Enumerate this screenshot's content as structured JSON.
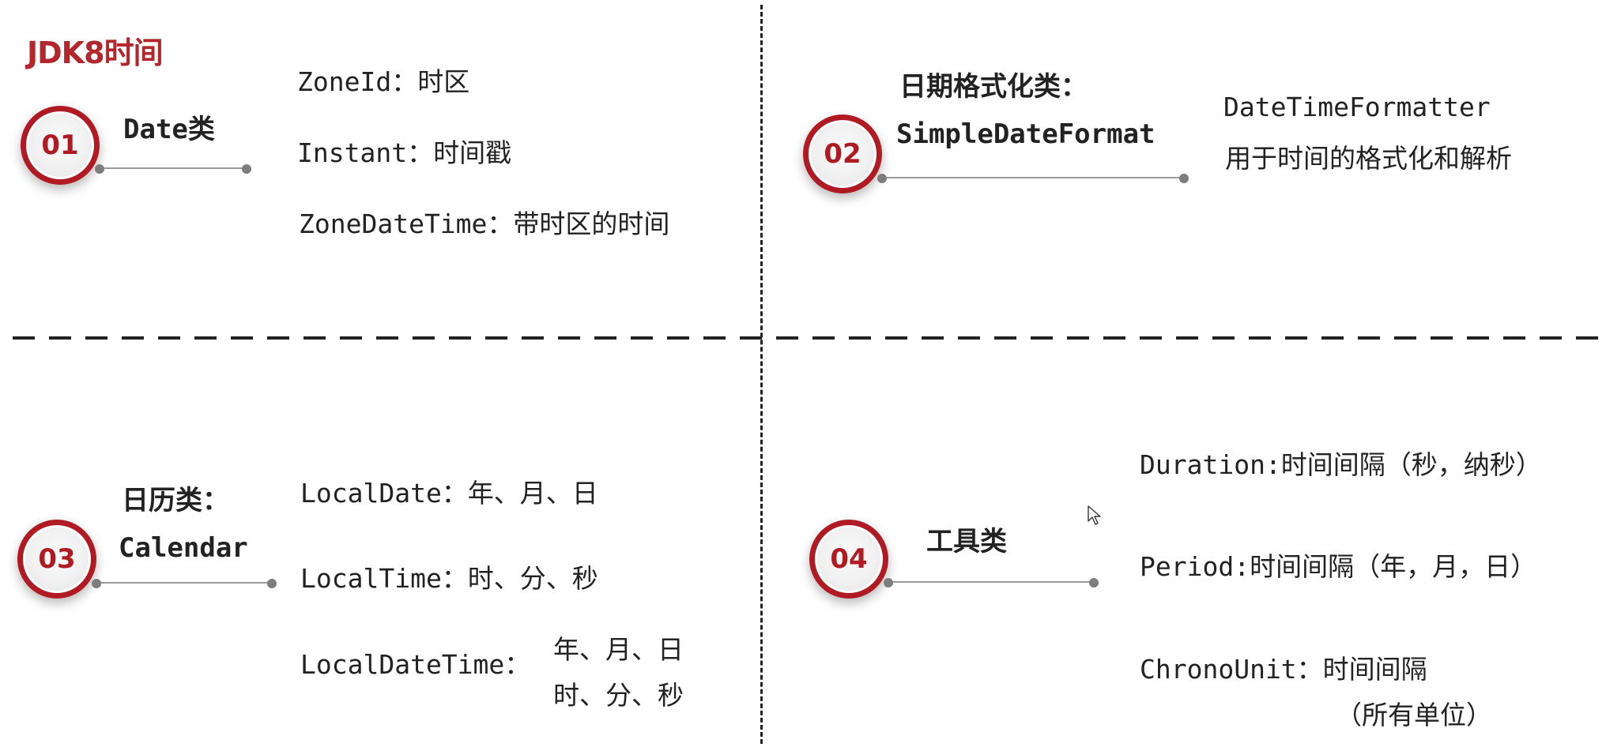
{
  "title": "JDK8时间",
  "sections": [
    {
      "number": "01",
      "heading": [
        "Date类"
      ],
      "items": [
        "ZoneId：时区",
        "Instant：时间戳",
        "ZoneDateTime：带时区的时间"
      ]
    },
    {
      "number": "02",
      "heading": [
        "日期格式化类：",
        "SimpleDateFormat"
      ],
      "items": [
        "DateTimeFormatter",
        "用于时间的格式化和解析"
      ]
    },
    {
      "number": "03",
      "heading": [
        "日历类：",
        "Calendar"
      ],
      "items": [
        "LocalDate：年、月、日",
        "LocalTime：时、分、秒",
        "LocalDateTime：",
        "年、月、日",
        "时、分、秒"
      ]
    },
    {
      "number": "04",
      "heading": [
        "工具类"
      ],
      "items": [
        "Duration:时间间隔（秒，纳秒）",
        "Period:时间间隔（年，月，日）",
        "ChronoUnit：时间间隔",
        "（所有单位）"
      ]
    }
  ],
  "colors": {
    "accent": "#b01a22",
    "title": "#b3262b",
    "connector": "#9a9a9a"
  }
}
